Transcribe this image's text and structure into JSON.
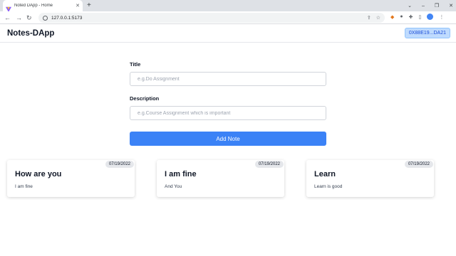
{
  "browser": {
    "tab_title": "Noted DApp - Home",
    "url": "127.0.0.1:5173"
  },
  "header": {
    "brand": "Notes-DApp",
    "wallet": "0X88E19...DA21"
  },
  "form": {
    "title_label": "Title",
    "title_placeholder": "e.g.Do Assignment",
    "description_label": "Description",
    "description_placeholder": "e.g.Course Assignment which is important",
    "submit_label": "Add Note"
  },
  "notes": [
    {
      "date": "07/19/2022",
      "title": "How are you",
      "description": "I am fine"
    },
    {
      "date": "07/19/2022",
      "title": "I am fine",
      "description": "And You"
    },
    {
      "date": "07/19/2022",
      "title": "Learn",
      "description": "Learn is good"
    }
  ],
  "colors": {
    "accent": "#3b82f6",
    "wallet_bg": "#bfdbfe",
    "wallet_text": "#1d4ed8"
  }
}
